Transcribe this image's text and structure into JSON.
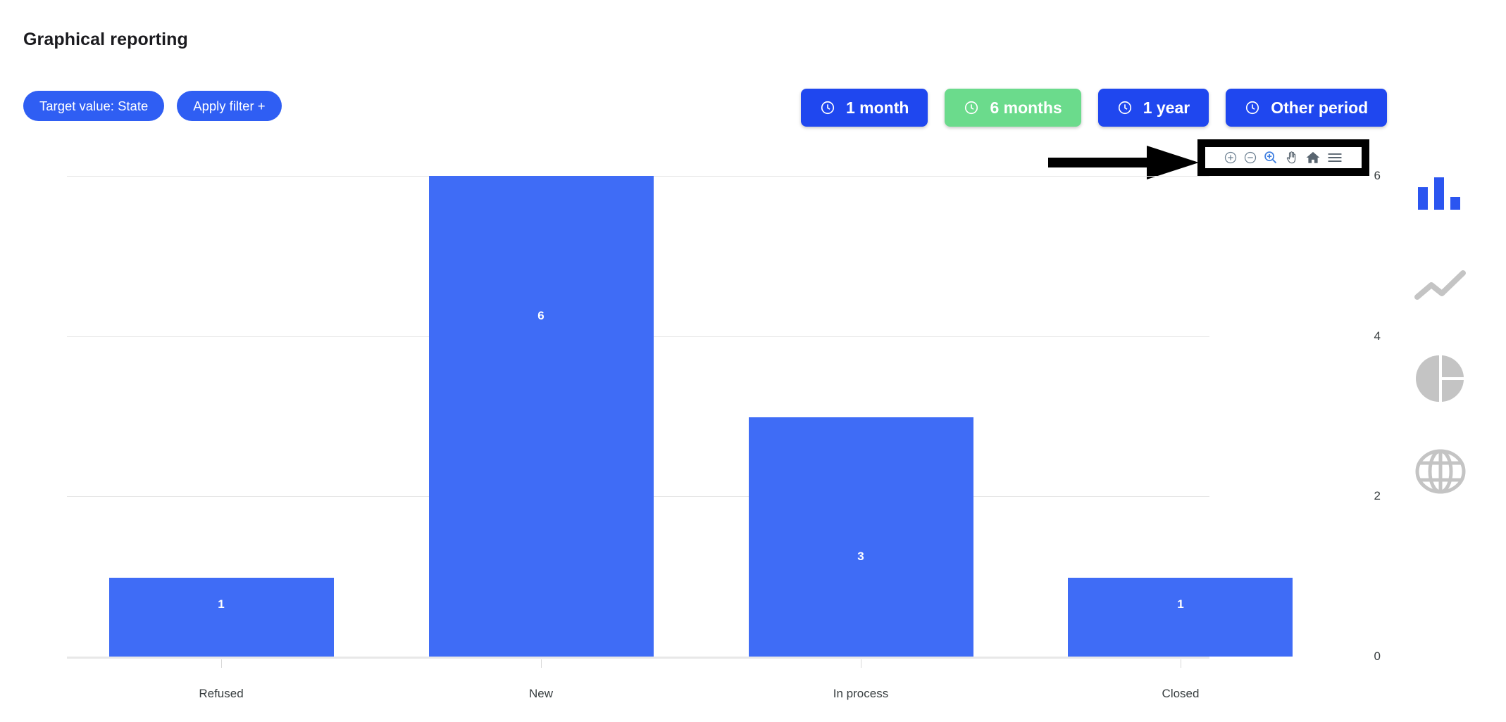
{
  "header": {
    "title": "Graphical reporting"
  },
  "filters": [
    {
      "name": "target-value",
      "label": "Target value: State"
    },
    {
      "name": "apply-filter",
      "label": "Apply filter +"
    }
  ],
  "periods": [
    {
      "name": "1-month",
      "label": "1 month",
      "icon": "clock-icon",
      "active": false
    },
    {
      "name": "6-months",
      "label": "6 months",
      "icon": "clock-icon",
      "active": true
    },
    {
      "name": "1-year",
      "label": "1 year",
      "icon": "clock-icon",
      "active": false
    },
    {
      "name": "other-period",
      "label": "Other period",
      "icon": "clock-icon",
      "active": false
    }
  ],
  "chart_toolbar": {
    "highlighted": true,
    "highlight_color": "#000000",
    "items": [
      {
        "name": "zoom-in-icon",
        "title": "Zoom In",
        "active": false
      },
      {
        "name": "zoom-out-icon",
        "title": "Zoom Out",
        "active": false
      },
      {
        "name": "selection-zoom-icon",
        "title": "Selection Zoom",
        "active": true
      },
      {
        "name": "pan-icon",
        "title": "Panning",
        "active": false
      },
      {
        "name": "home-reset-icon",
        "title": "Reset Zoom",
        "active": false
      },
      {
        "name": "menu-icon",
        "title": "Menu",
        "active": false
      }
    ]
  },
  "annotation": {
    "name": "pointer-arrow",
    "color": "#000000"
  },
  "chart_type_rail": [
    {
      "name": "bar-chart-icon",
      "label": "Bar chart",
      "active": true
    },
    {
      "name": "line-chart-icon",
      "label": "Line chart",
      "active": false
    },
    {
      "name": "pie-chart-icon",
      "label": "Pie chart",
      "active": false
    },
    {
      "name": "map-globe-icon",
      "label": "Map",
      "active": false
    }
  ],
  "colors": {
    "bar": "#3f6cf6",
    "accent_blue": "#1f47ef",
    "pill_blue": "#2f5ef3",
    "active_green": "#6bdb8c",
    "grid": "#e6e6e6",
    "axis_text": "#373d3f",
    "rail_inactive": "#c4c4c4"
  },
  "chart_data": {
    "type": "bar",
    "title": "",
    "xlabel": "",
    "ylabel": "",
    "categories": [
      "Refused",
      "New",
      "In process",
      "Closed"
    ],
    "values": [
      1,
      6,
      3,
      1
    ],
    "data_labels": [
      "1",
      "6",
      "3",
      "1"
    ],
    "yticks": [
      6,
      4,
      2,
      0
    ],
    "ylim": [
      0,
      6
    ],
    "grid": true,
    "legend": "none",
    "series": [
      {
        "name": "State",
        "values": [
          1,
          6,
          3,
          1
        ]
      }
    ]
  }
}
